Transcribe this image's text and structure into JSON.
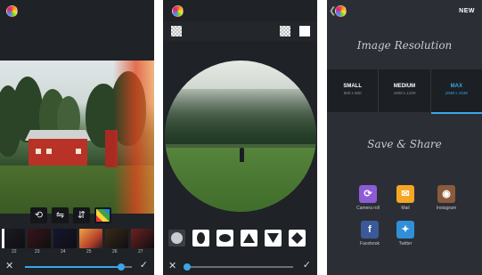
{
  "screens": {
    "filters": {
      "thumbnail_labels": [
        "22",
        "23",
        "24",
        "25",
        "26",
        "27"
      ],
      "thumbnail_colors": [
        "#1b1b22",
        "#3a1418",
        "#15162e",
        "#c76a2c",
        "#3a2a18",
        "#702020"
      ],
      "slider_value": 0.9
    },
    "shapes": {
      "slider_value": 0.02,
      "shape_icons": [
        "circle-icon",
        "oval-icon",
        "ellipse-icon",
        "triangle-up-icon",
        "triangle-down-icon",
        "diamond-icon"
      ]
    },
    "export": {
      "header": {
        "new_label": "NEW"
      },
      "image_resolution_title": "Image Resolution",
      "resolutions": [
        {
          "name": "SMALL",
          "size": "800 x 600"
        },
        {
          "name": "MEDIUM",
          "size": "1600 x 1200"
        },
        {
          "name": "MAX",
          "size": "2048 x 1536"
        }
      ],
      "selected_resolution": "MAX",
      "save_share_title": "Save & Share",
      "share_options": [
        {
          "label": "Camera roll",
          "icon": "camera-roll-icon",
          "color": "#8e5bd6"
        },
        {
          "label": "Mail",
          "icon": "mail-icon",
          "color": "#f5a623"
        },
        {
          "label": "Instagram",
          "icon": "instagram-icon",
          "color": "#8a5a3c"
        },
        {
          "label": "Facebook",
          "icon": "facebook-icon",
          "color": "#3b5998"
        },
        {
          "label": "Twitter",
          "icon": "twitter-icon",
          "color": "#2f8fd8"
        }
      ]
    }
  },
  "colors": {
    "accent": "#39a7e8",
    "panel": "#1f2227"
  }
}
